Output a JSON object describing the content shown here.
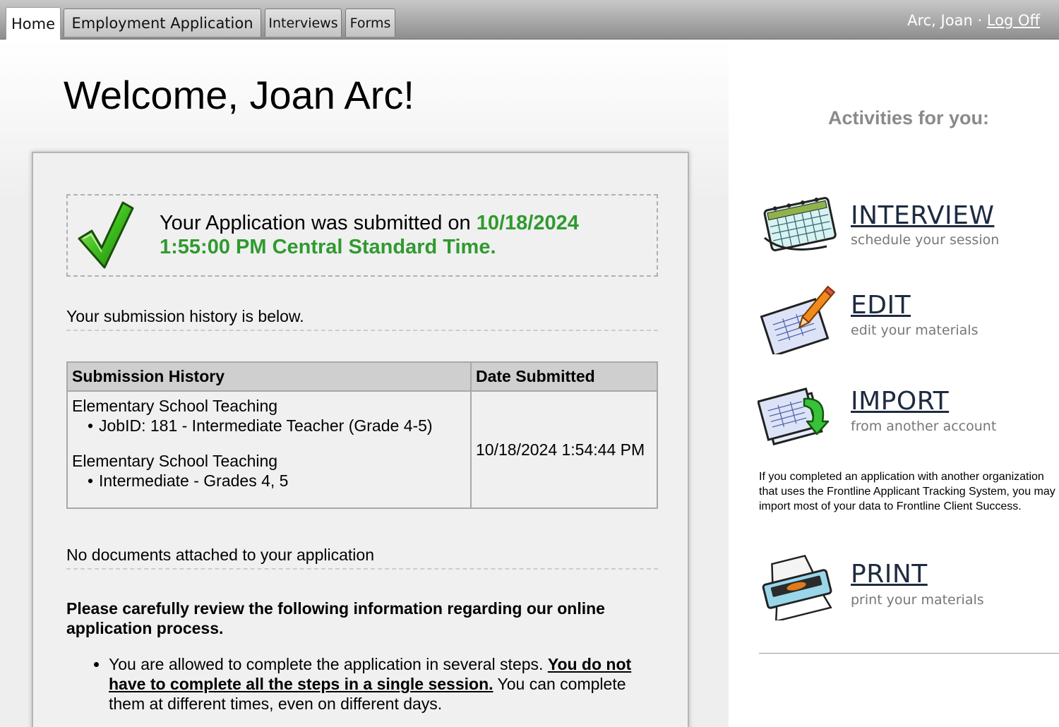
{
  "tabs": [
    {
      "label": "Home",
      "active": true
    },
    {
      "label": "Employment Application",
      "active": false
    },
    {
      "label": "Interviews",
      "active": false
    },
    {
      "label": "Forms",
      "active": false
    }
  ],
  "user": {
    "name": "Arc, Joan",
    "separator": "·",
    "logoff_label": "Log Off"
  },
  "welcome": "Welcome, Joan Arc!",
  "submission": {
    "prefix": "Your Application was submitted on",
    "datetime": "10/18/2024 1:55:00 PM Central Standard Time."
  },
  "history_note": "Your submission history is below.",
  "history_table": {
    "headers": [
      "Submission History",
      "Date Submitted"
    ],
    "groups": [
      {
        "title": "Elementary School Teaching",
        "bullet": "JobID: 181 - Intermediate Teacher (Grade 4-5)"
      },
      {
        "title": "Elementary School Teaching",
        "bullet": "Intermediate - Grades 4, 5"
      }
    ],
    "date": "10/18/2024 1:54:44 PM"
  },
  "no_docs": "No documents attached to your application",
  "review": {
    "heading": "Please carefully review the following information regarding our online application process.",
    "items": [
      {
        "before": "You are allowed to complete the application in several steps.",
        "emphasis": "You do not have to complete all the steps in a single session.",
        "after": "You can complete them at different times, even on different days."
      }
    ]
  },
  "activities": {
    "title": "Activities for you:",
    "items": [
      {
        "label": "INTERVIEW",
        "sub": "schedule your session",
        "icon": "calendar-icon"
      },
      {
        "label": "EDIT",
        "sub": "edit your materials",
        "icon": "pencil-document-icon"
      },
      {
        "label": "IMPORT",
        "sub": "from another account",
        "icon": "import-documents-icon"
      },
      {
        "label": "PRINT",
        "sub": "print your materials",
        "icon": "printer-icon"
      }
    ],
    "import_note": "If you completed an application with another organization that uses the Frontline Applicant Tracking System, you may import most of your data to Frontline Client Success."
  },
  "colors": {
    "accent_green": "#2f9a2f",
    "tab_bar": "#a5a5a5",
    "activity_label": "#1e2b40"
  }
}
